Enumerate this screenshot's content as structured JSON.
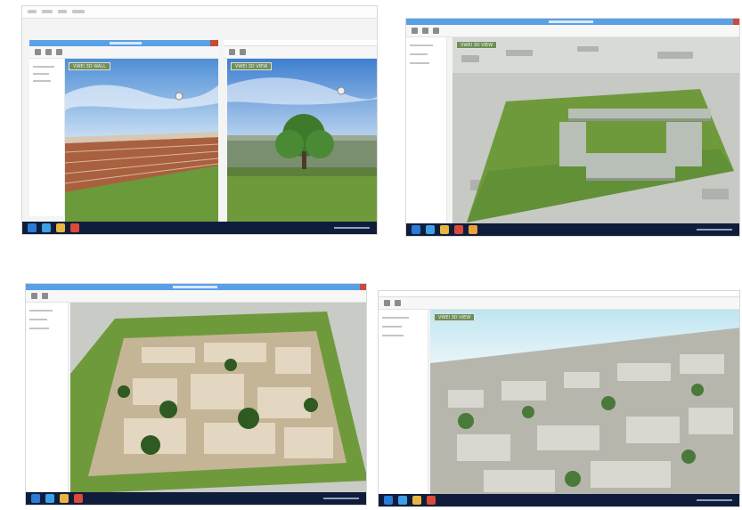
{
  "screens": [
    {
      "id": "top-left",
      "views": [
        {
          "label": "VWEI 3D WALL"
        },
        {
          "label": "VWEI 3D VIEW"
        }
      ]
    },
    {
      "id": "top-right",
      "views": [
        {
          "label": "VWEI 3D VIEW"
        }
      ]
    },
    {
      "id": "bottom-left",
      "views": [
        {
          "label": ""
        }
      ]
    },
    {
      "id": "bottom-right",
      "views": [
        {
          "label": "VWEI 3D VIEW"
        }
      ]
    }
  ],
  "colors": {
    "sky_blue": "#7fb6e8",
    "grass_green": "#6f9a3c",
    "building_tan": "#cbb79a",
    "brick": "#9a5a3a",
    "taskbar": "#101d3a",
    "title_bar": "#5aa0e6"
  }
}
